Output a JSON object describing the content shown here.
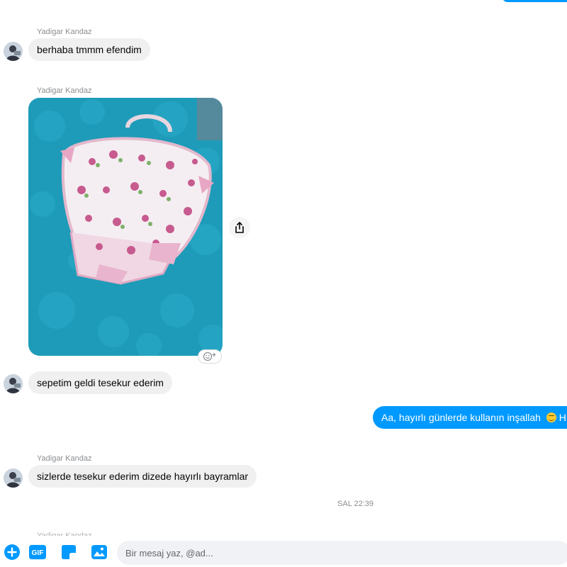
{
  "colors": {
    "accent": "#0099ff",
    "incoming_bubble": "#f0f0f0",
    "meta_text": "#8a8d91"
  },
  "messages": [
    {
      "sender": "Yadigar Kandaz",
      "text": "berhaba tmmm efendim"
    },
    {
      "sender": "Yadigar Kandaz",
      "type": "photo",
      "description_icon": "photo-basket"
    },
    {
      "text": "sepetim geldi tesekur ederim"
    },
    {
      "outgoing": true,
      "text": "Aa, hayırlı günlerde kullanın inşallah",
      "trailing": "H"
    },
    {
      "sender": "Yadigar Kandaz",
      "text": "sizlerde tesekur ederim dizede hayırlı bayramlar"
    }
  ],
  "timestamp": "SAL 22:39",
  "cut_off_sender": "Yadigar Kandaz",
  "composer": {
    "placeholder": "Bir mesaj yaz, @ad...",
    "gif_label": "GIF",
    "icons": [
      "plus-circle-icon",
      "gif-icon",
      "sticker-icon",
      "image-icon"
    ]
  }
}
